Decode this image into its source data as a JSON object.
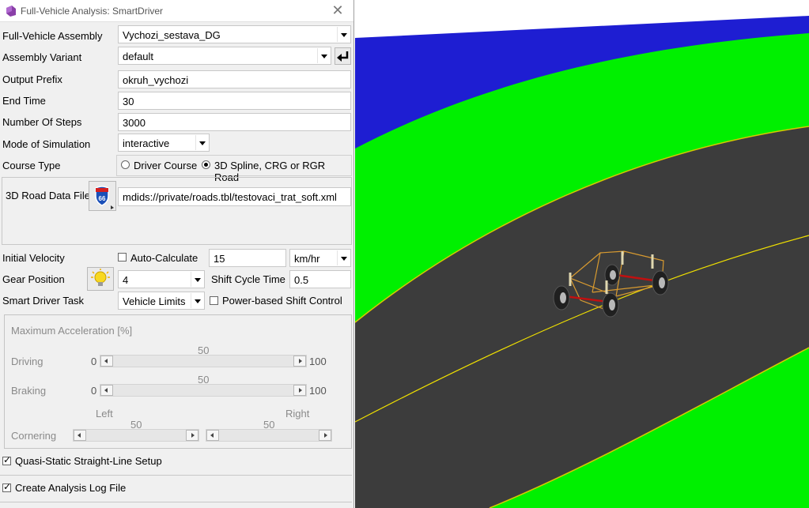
{
  "dialog": {
    "title": "Full-Vehicle Analysis: SmartDriver",
    "assembly": {
      "label": "Full-Vehicle Assembly",
      "value": "Vychozi_sestava_DG"
    },
    "variant": {
      "label": "Assembly Variant",
      "value": "default"
    },
    "output_prefix": {
      "label": "Output Prefix",
      "value": "okruh_vychozi"
    },
    "end_time": {
      "label": "End Time",
      "value": "30"
    },
    "steps": {
      "label": "Number Of Steps",
      "value": "3000"
    },
    "mode": {
      "label": "Mode of Simulation",
      "value": "interactive"
    },
    "course_type": {
      "label": "Course Type",
      "option1": "Driver Course",
      "option2": "3D Spline, CRG or RGR Road",
      "selected": "3D Spline, CRG or RGR Road"
    },
    "road_file": {
      "label": "3D Road Data File",
      "value": "mdids://private/roads.tbl/testovaci_trat_soft.xml",
      "icon_text": "66"
    },
    "initial_velocity": {
      "label": "Initial Velocity",
      "auto_label": "Auto-Calculate",
      "value": "15",
      "unit": "km/hr"
    },
    "gear": {
      "label": "Gear Position",
      "value": "4",
      "shift_label": "Shift Cycle Time",
      "shift_value": "0.5"
    },
    "task": {
      "label": "Smart Driver Task",
      "value": "Vehicle Limits",
      "power_label": "Power-based Shift Control"
    },
    "max_accel": {
      "title": "Maximum Acceleration [%]",
      "driving": {
        "label": "Driving",
        "min": "0",
        "max": "100",
        "value": "50"
      },
      "braking": {
        "label": "Braking",
        "min": "0",
        "max": "100",
        "value": "50"
      },
      "cornering": {
        "label": "Cornering",
        "left_label": "Left",
        "right_label": "Right",
        "left_value": "50",
        "right_value": "50"
      }
    },
    "quasi_static": {
      "label": "Quasi-Static Straight-Line Setup",
      "checked": true
    },
    "log_file": {
      "label": "Create Analysis Log File",
      "checked": true
    }
  },
  "colors": {
    "sky": "#1e1ed2",
    "grass": "#00f000",
    "road": "#3c3c3c",
    "centerline": "#f0e000",
    "edge": "#d8c800"
  }
}
